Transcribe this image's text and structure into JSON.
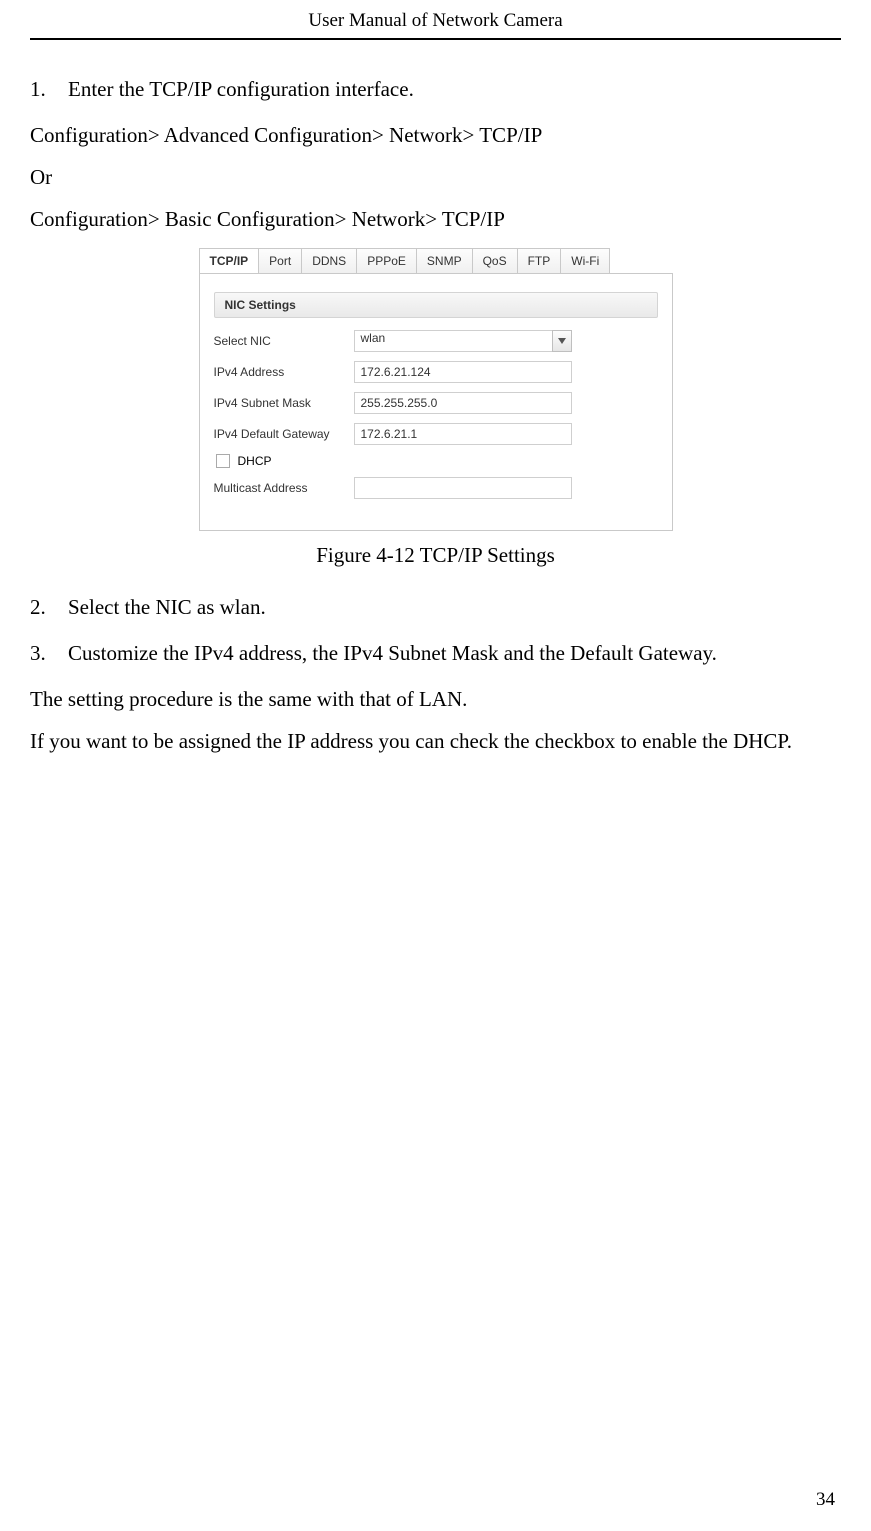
{
  "header": {
    "title": "User Manual of Network Camera"
  },
  "steps": {
    "s1_num": "1.",
    "s1_text": "Enter the TCP/IP configuration interface.",
    "path1": "Configuration> Advanced Configuration> Network> TCP/IP",
    "or": "Or",
    "path2": "Configuration> Basic Configuration> Network> TCP/IP",
    "s2_num": "2.",
    "s2_text": "Select the NIC as wlan.",
    "s3_num": "3.",
    "s3_text": "Customize the IPv4 address, the IPv4 Subnet Mask and the Default Gateway.",
    "p_same": "The setting procedure is the same with that of LAN.",
    "p_dhcp": "If you want to be assigned the IP address you can check the checkbox to enable the DHCP."
  },
  "figure": {
    "tabs": [
      "TCP/IP",
      "Port",
      "DDNS",
      "PPPoE",
      "SNMP",
      "QoS",
      "FTP",
      "Wi-Fi"
    ],
    "section_title": "NIC Settings",
    "rows": {
      "select_nic_label": "Select NIC",
      "select_nic_value": "wlan",
      "ipv4_addr_label": "IPv4 Address",
      "ipv4_addr_value": "172.6.21.124",
      "ipv4_mask_label": "IPv4 Subnet Mask",
      "ipv4_mask_value": "255.255.255.0",
      "ipv4_gw_label": "IPv4 Default Gateway",
      "ipv4_gw_value": "172.6.21.1",
      "dhcp_label": "DHCP",
      "multicast_label": "Multicast Address",
      "multicast_value": ""
    },
    "caption": "Figure 4-12 TCP/IP Settings"
  },
  "page_number": "34"
}
